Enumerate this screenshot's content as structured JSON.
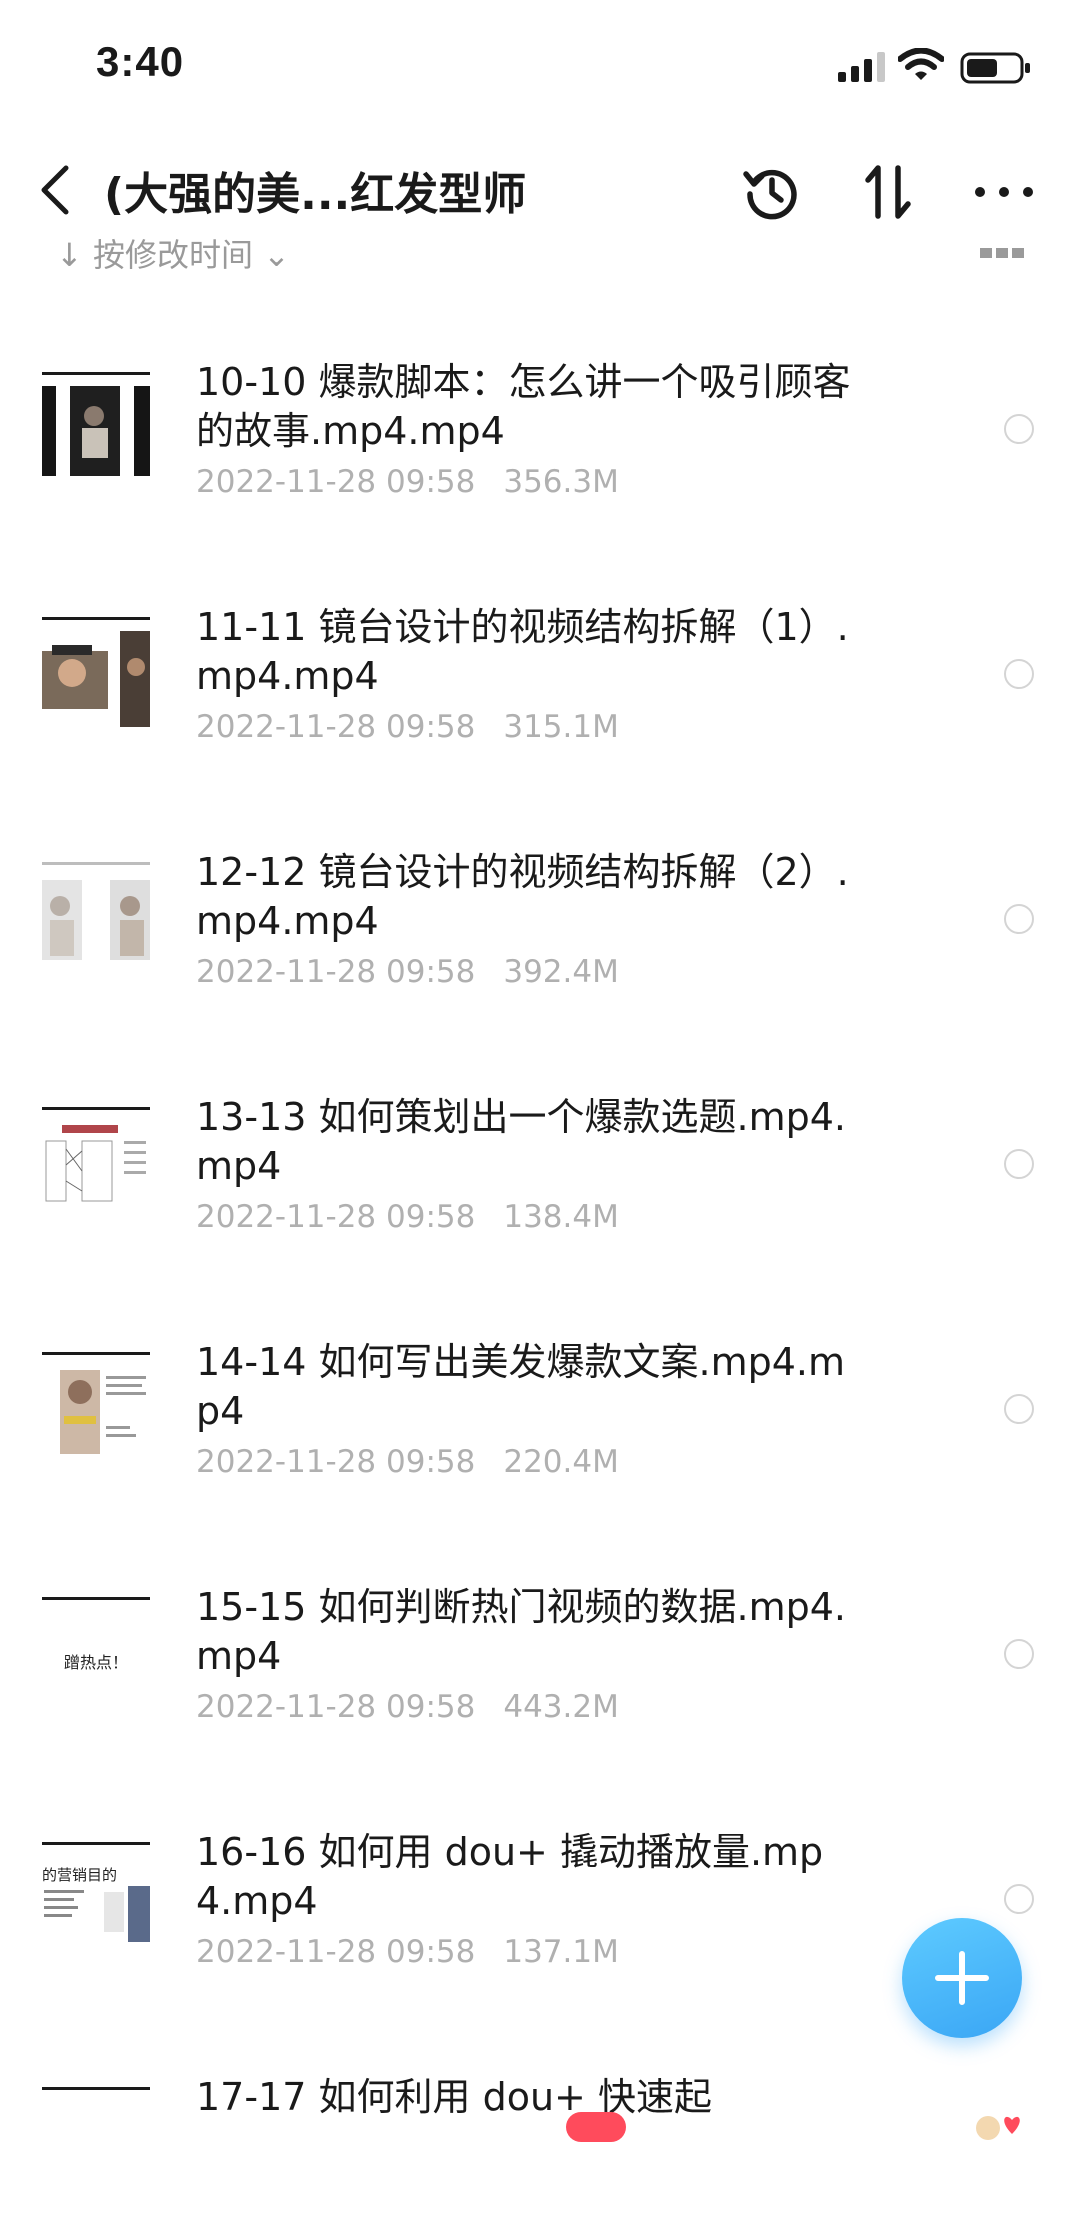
{
  "status_bar": {
    "time": "3:40"
  },
  "header": {
    "title": "(大强的美...红发型师"
  },
  "sort_bar": {
    "label": "↓ 按修改时间 ⌄"
  },
  "files": [
    {
      "name": "10-10 爆款脚本：怎么讲一个吸引顾客的故事.mp4.mp4",
      "date": "2022-11-28 09:58",
      "size": "356.3M"
    },
    {
      "name": "11-11 镜台设计的视频结构拆解（1）.mp4.mp4",
      "date": "2022-11-28 09:58",
      "size": "315.1M"
    },
    {
      "name": "12-12 镜台设计的视频结构拆解（2）.mp4.mp4",
      "date": "2022-11-28 09:58",
      "size": "392.4M"
    },
    {
      "name": "13-13 如何策划出一个爆款选题.mp4.mp4",
      "date": "2022-11-28 09:58",
      "size": "138.4M"
    },
    {
      "name": "14-14 如何写出美发爆款文案.mp4.mp4",
      "date": "2022-11-28 09:58",
      "size": "220.4M"
    },
    {
      "name": "15-15 如何判断热门视频的数据.mp4.mp4",
      "date": "2022-11-28 09:58",
      "size": "443.2M"
    },
    {
      "name": "16-16 如何用 dou+ 撬动播放量.mp4.mp4",
      "date": "2022-11-28 09:58",
      "size": "137.1M"
    },
    {
      "name": "17-17 如何利用 dou+ 快速起",
      "date": "",
      "size": ""
    }
  ],
  "thumbnails": {
    "t6_caption": "蹭热点！",
    "t7_caption": "的营销目的"
  },
  "colors": {
    "fab": "#3aa6f5",
    "meta_text": "#b0b0b0",
    "badge": "#ff4b5c"
  }
}
